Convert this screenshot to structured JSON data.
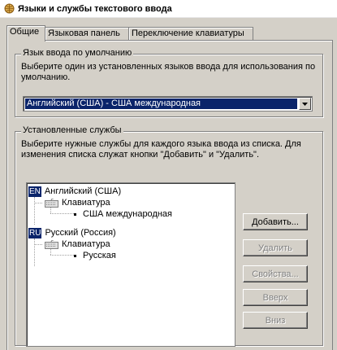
{
  "window": {
    "title": "Языки и службы текстового ввода",
    "icon": "keyboard-globe-icon"
  },
  "tabs": [
    {
      "label": "Общие",
      "active": true
    },
    {
      "label": "Языковая панель",
      "active": false
    },
    {
      "label": "Переключение клавиатуры",
      "active": false
    }
  ],
  "default_language": {
    "legend": "Язык ввода по умолчанию",
    "description": "Выберите один из установленных языков ввода для использования по умолчанию.",
    "selected": "Английский (США) - США международная"
  },
  "services": {
    "legend": "Установленные службы",
    "description": "Выберите нужные службы для каждого языка ввода из списка. Для изменения списка служат кнопки \"Добавить\" и \"Удалить\".",
    "tree": [
      {
        "badge": "EN",
        "language": "Английский (США)",
        "category": "Клавиатура",
        "layout": "США международная"
      },
      {
        "badge": "RU",
        "language": "Русский (Россия)",
        "category": "Клавиатура",
        "layout": "Русская"
      }
    ]
  },
  "buttons": {
    "add": "Добавить...",
    "remove": "Удалить",
    "properties": "Свойства...",
    "up": "Вверх",
    "down": "Вниз"
  }
}
